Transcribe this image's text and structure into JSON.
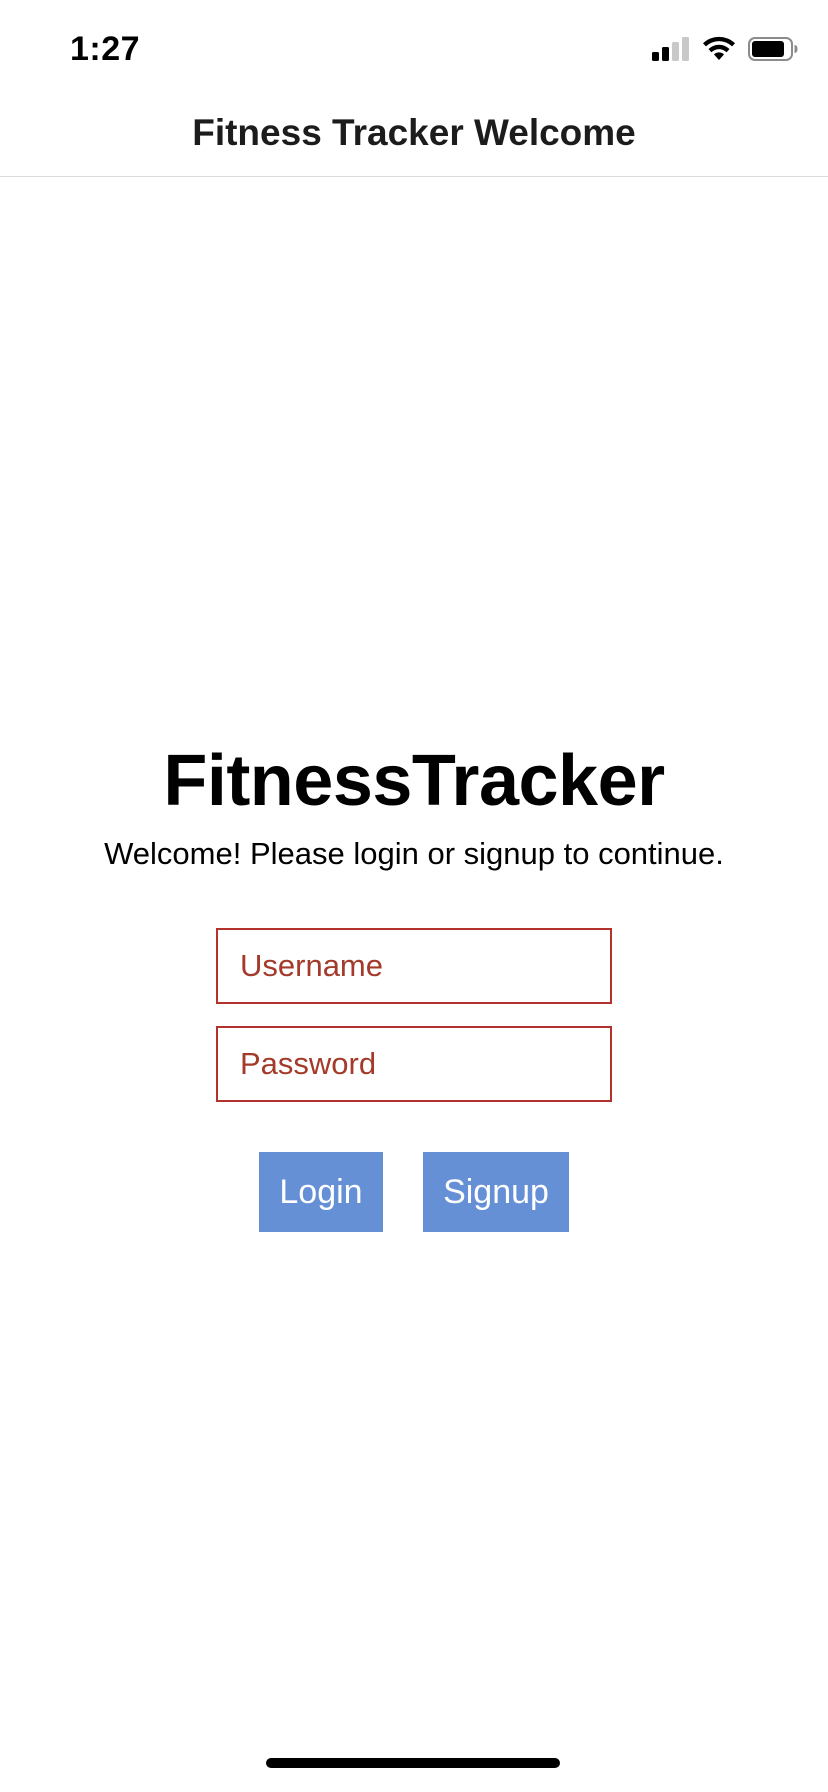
{
  "status_bar": {
    "time": "1:27",
    "icons": [
      "signal-icon",
      "wifi-icon",
      "battery-icon"
    ]
  },
  "nav": {
    "title": "Fitness Tracker Welcome"
  },
  "main": {
    "app_name": "FitnessTracker",
    "welcome": "Welcome! Please login or signup to continue.",
    "username_placeholder": "Username",
    "password_placeholder": "Password",
    "login_label": "Login",
    "signup_label": "Signup"
  },
  "colors": {
    "field_border": "#b3322c",
    "placeholder": "#a33a2a",
    "button_bg": "#6590d6",
    "button_text": "#ffffff"
  }
}
